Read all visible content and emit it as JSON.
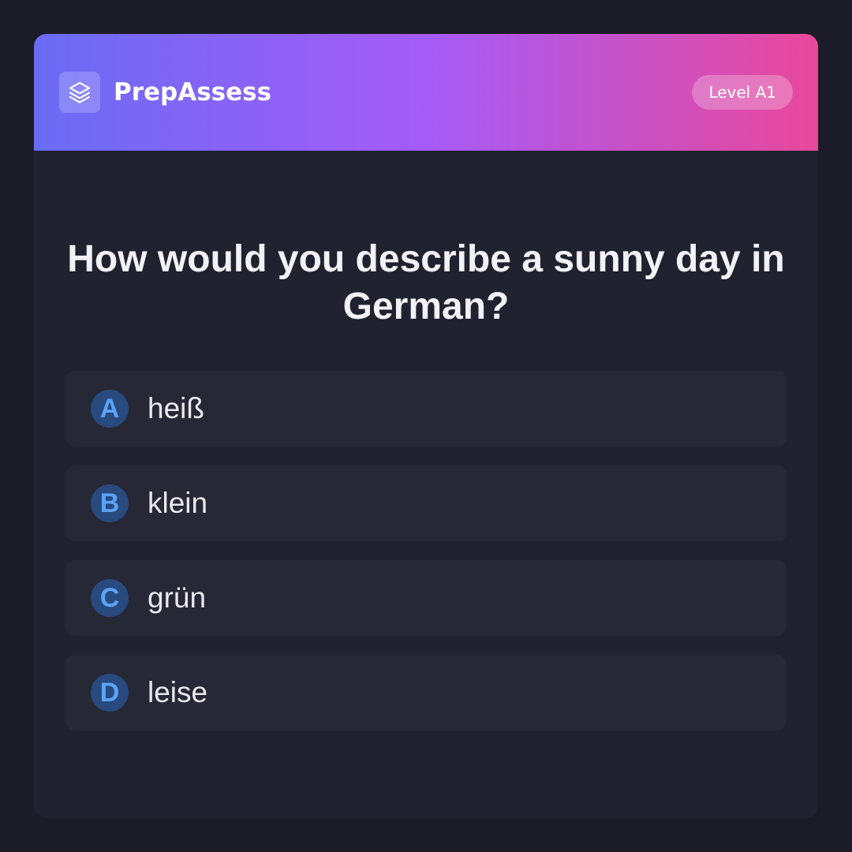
{
  "header": {
    "brand_name": "PrepAssess",
    "brand_icon": "layers-icon",
    "level_badge": "Level A1",
    "gradient_colors": [
      "#6a6cf5",
      "#a55bf6",
      "#e9489a"
    ]
  },
  "question": {
    "text": "How would you describe a sunny day in German?"
  },
  "options": [
    {
      "letter": "A",
      "text": "heiß"
    },
    {
      "letter": "B",
      "text": "klein"
    },
    {
      "letter": "C",
      "text": "grün"
    },
    {
      "letter": "D",
      "text": "leise"
    }
  ],
  "colors": {
    "page_background": "#1b1c27",
    "card_background": "#202230",
    "option_background": "#262836",
    "letter_circle": "#284a7e",
    "letter_text": "#5ba3f5"
  }
}
